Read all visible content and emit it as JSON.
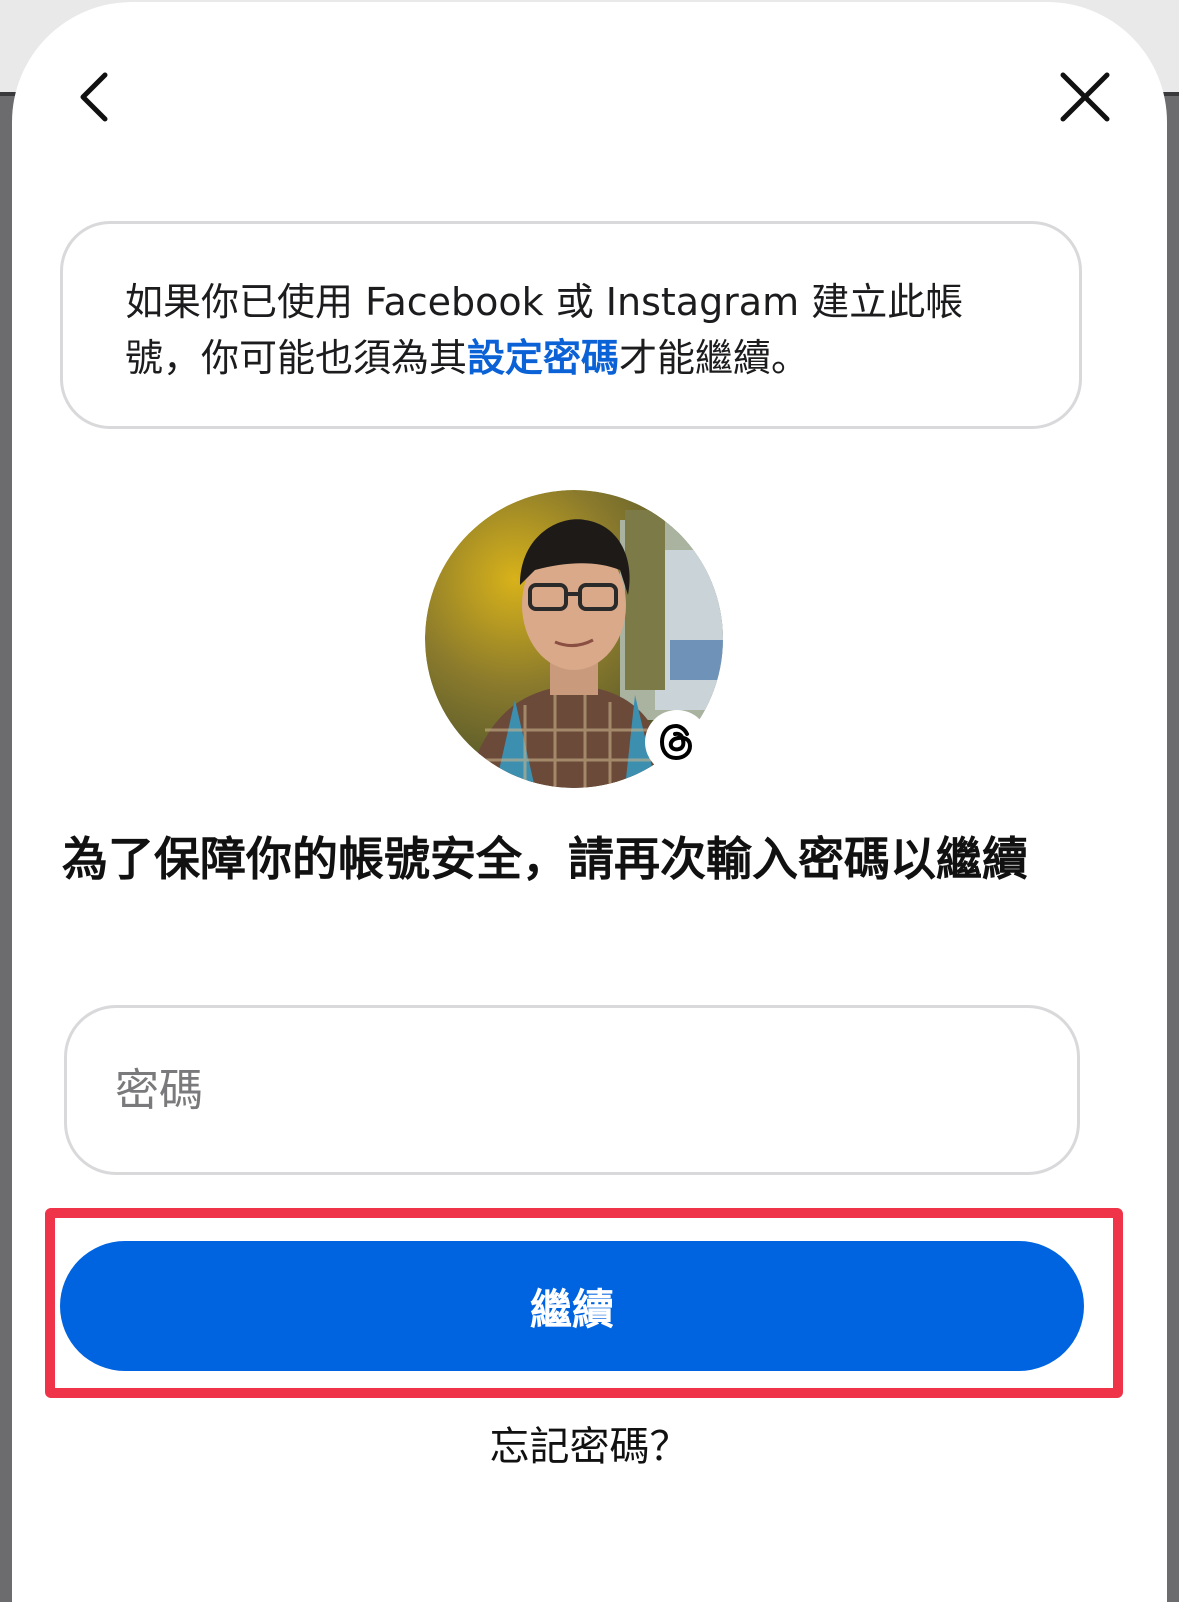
{
  "colors": {
    "accent": "#0064e0",
    "link": "#0a62d6",
    "highlight": "#ef3348",
    "border": "#d9d9db"
  },
  "nav": {
    "back_icon": "chevron-left-icon",
    "close_icon": "close-icon"
  },
  "notice": {
    "text_before": "如果你已使用 Facebook 或 Instagram 建立此帳號，你可能也須為其",
    "link_text": "設定密碼",
    "text_after": "才能繼續。"
  },
  "profile": {
    "avatar": "profile-photo",
    "badge_icon": "threads-logo-icon"
  },
  "prompt": {
    "headline": "為了保障你的帳號安全，請再次輸入密碼以繼續"
  },
  "password": {
    "placeholder": "密碼",
    "value": ""
  },
  "actions": {
    "continue_label": "繼續",
    "forgot_label": "忘記密碼？"
  }
}
